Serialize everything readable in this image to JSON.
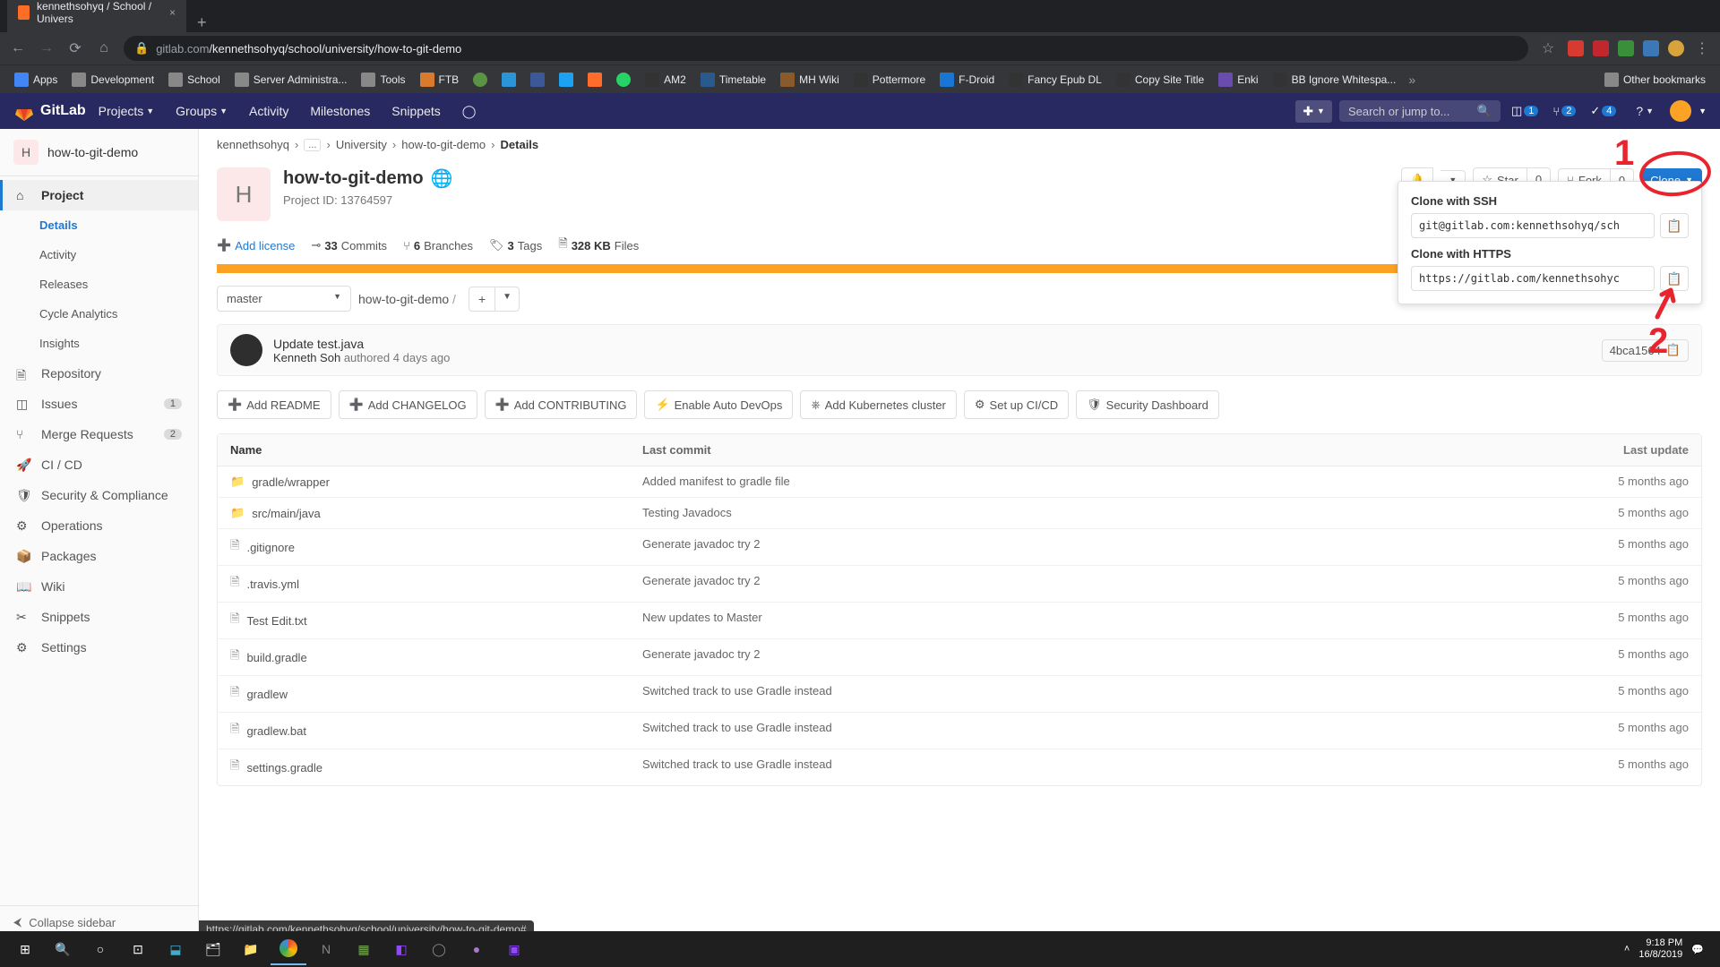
{
  "browser": {
    "tab_title": "kennethsohyq / School / Univers",
    "url_host": "gitlab.com",
    "url_path": "/kennethsohyq/school/university/how-to-git-demo",
    "bookmarks": [
      "Apps",
      "Development",
      "School",
      "Server Administra...",
      "Tools",
      "FTB",
      "",
      "",
      "",
      "",
      "",
      "",
      "AM2",
      "Timetable",
      "MH Wiki",
      "Pottermore",
      "F-Droid",
      "Fancy Epub DL",
      "Copy Site Title",
      "Enki",
      "BB Ignore Whitespa..."
    ],
    "other_bookmarks": "Other bookmarks"
  },
  "gitlab_nav": {
    "brand": "GitLab",
    "projects": "Projects",
    "groups": "Groups",
    "activity": "Activity",
    "milestones": "Milestones",
    "snippets": "Snippets",
    "search_placeholder": "Search or jump to...",
    "issue_count": "1",
    "mr_count": "2",
    "todo_count": "4"
  },
  "sidebar": {
    "project_initial": "H",
    "project_name": "how-to-git-demo",
    "items": [
      {
        "icon": "home",
        "label": "Project",
        "active": true
      },
      {
        "sub": true,
        "label": "Details",
        "selected": true
      },
      {
        "sub": true,
        "label": "Activity"
      },
      {
        "sub": true,
        "label": "Releases"
      },
      {
        "sub": true,
        "label": "Cycle Analytics"
      },
      {
        "sub": true,
        "label": "Insights"
      },
      {
        "icon": "doc",
        "label": "Repository"
      },
      {
        "icon": "issues",
        "label": "Issues",
        "count": "1"
      },
      {
        "icon": "mr",
        "label": "Merge Requests",
        "count": "2"
      },
      {
        "icon": "rocket",
        "label": "CI / CD"
      },
      {
        "icon": "shield",
        "label": "Security & Compliance"
      },
      {
        "icon": "ops",
        "label": "Operations"
      },
      {
        "icon": "pkg",
        "label": "Packages"
      },
      {
        "icon": "book",
        "label": "Wiki"
      },
      {
        "icon": "scissors",
        "label": "Snippets"
      },
      {
        "icon": "gear",
        "label": "Settings"
      }
    ],
    "collapse": "Collapse sidebar"
  },
  "breadcrumb": [
    "kennethsohyq",
    "...",
    "University",
    "how-to-git-demo",
    "Details"
  ],
  "project": {
    "initial": "H",
    "title": "how-to-git-demo",
    "id_label": "Project ID: 13764597",
    "star": "Star",
    "star_count": "0",
    "fork": "Fork",
    "fork_count": "0",
    "clone": "Clone"
  },
  "stats": {
    "add_license": "Add license",
    "commits_n": "33",
    "commits_l": "Commits",
    "branches_n": "6",
    "branches_l": "Branches",
    "tags_n": "3",
    "tags_l": "Tags",
    "size_n": "328 KB",
    "size_l": "Files"
  },
  "branch": {
    "selected": "master",
    "path": "how-to-git-demo",
    "sep": "/"
  },
  "commit": {
    "msg": "Update test.java",
    "author": "Kenneth Soh",
    "verb": "authored",
    "when": "4 days ago",
    "sha": "4bca1564"
  },
  "actions": [
    "Add README",
    "Add CHANGELOG",
    "Add CONTRIBUTING",
    "Enable Auto DevOps",
    "Add Kubernetes cluster",
    "Set up CI/CD",
    "Security Dashboard"
  ],
  "table": {
    "h_name": "Name",
    "h_commit": "Last commit",
    "h_update": "Last update",
    "rows": [
      {
        "type": "dir",
        "name": "gradle/wrapper",
        "commit": "Added manifest to gradle file",
        "update": "5 months ago"
      },
      {
        "type": "dir",
        "name": "src/main/java",
        "commit": "Testing Javadocs",
        "update": "5 months ago"
      },
      {
        "type": "file",
        "name": ".gitignore",
        "commit": "Generate javadoc try 2",
        "update": "5 months ago"
      },
      {
        "type": "file",
        "name": ".travis.yml",
        "commit": "Generate javadoc try 2",
        "update": "5 months ago"
      },
      {
        "type": "file",
        "name": "Test Edit.txt",
        "commit": "New updates to Master",
        "update": "5 months ago"
      },
      {
        "type": "file",
        "name": "build.gradle",
        "commit": "Generate javadoc try 2",
        "update": "5 months ago"
      },
      {
        "type": "file",
        "name": "gradlew",
        "commit": "Switched track to use Gradle instead",
        "update": "5 months ago"
      },
      {
        "type": "file",
        "name": "gradlew.bat",
        "commit": "Switched track to use Gradle instead",
        "update": "5 months ago"
      },
      {
        "type": "file",
        "name": "settings.gradle",
        "commit": "Switched track to use Gradle instead",
        "update": "5 months ago"
      }
    ]
  },
  "clone_dropdown": {
    "ssh_label": "Clone with SSH",
    "ssh_url": "git@gitlab.com:kennethsohyq/sch",
    "https_label": "Clone with HTTPS",
    "https_url": "https://gitlab.com/kennethsohyc"
  },
  "annotations": {
    "one": "1",
    "two": "2"
  },
  "status_hover": "https://gitlab.com/kennethsohyq/school/university/how-to-git-demo#",
  "taskbar": {
    "time": "9:18 PM",
    "date": "16/8/2019"
  }
}
